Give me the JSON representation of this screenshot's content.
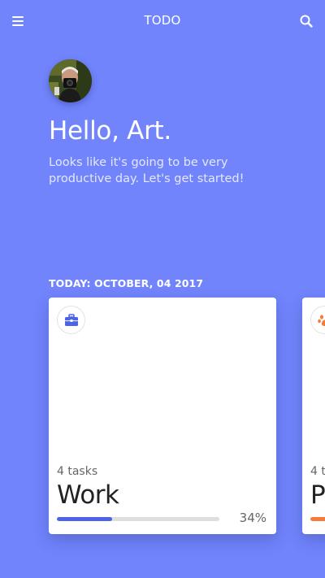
{
  "header": {
    "title": "TODO",
    "menu_icon": "menu-icon",
    "search_icon": "search-icon"
  },
  "user": {
    "greeting": "Hello, Art.",
    "subtitle": "Looks like it's going to be very productive day. Let's get started!"
  },
  "today": {
    "label": "TODAY: OCTOBER, 04 2017"
  },
  "cards": [
    {
      "icon": "briefcase-icon",
      "icon_color": "#4c63e6",
      "task_count": "4 tasks",
      "title": "Work",
      "progress": 0.34,
      "progress_label": "34%",
      "bar_color": "#4c63e6"
    },
    {
      "icon": "paw-icon",
      "icon_color": "#f47b3a",
      "task_count": "4 t",
      "title": "P",
      "bar_color": "#f47b3a"
    }
  ],
  "colors": {
    "background": "#7184fb",
    "card": "#ffffff"
  }
}
